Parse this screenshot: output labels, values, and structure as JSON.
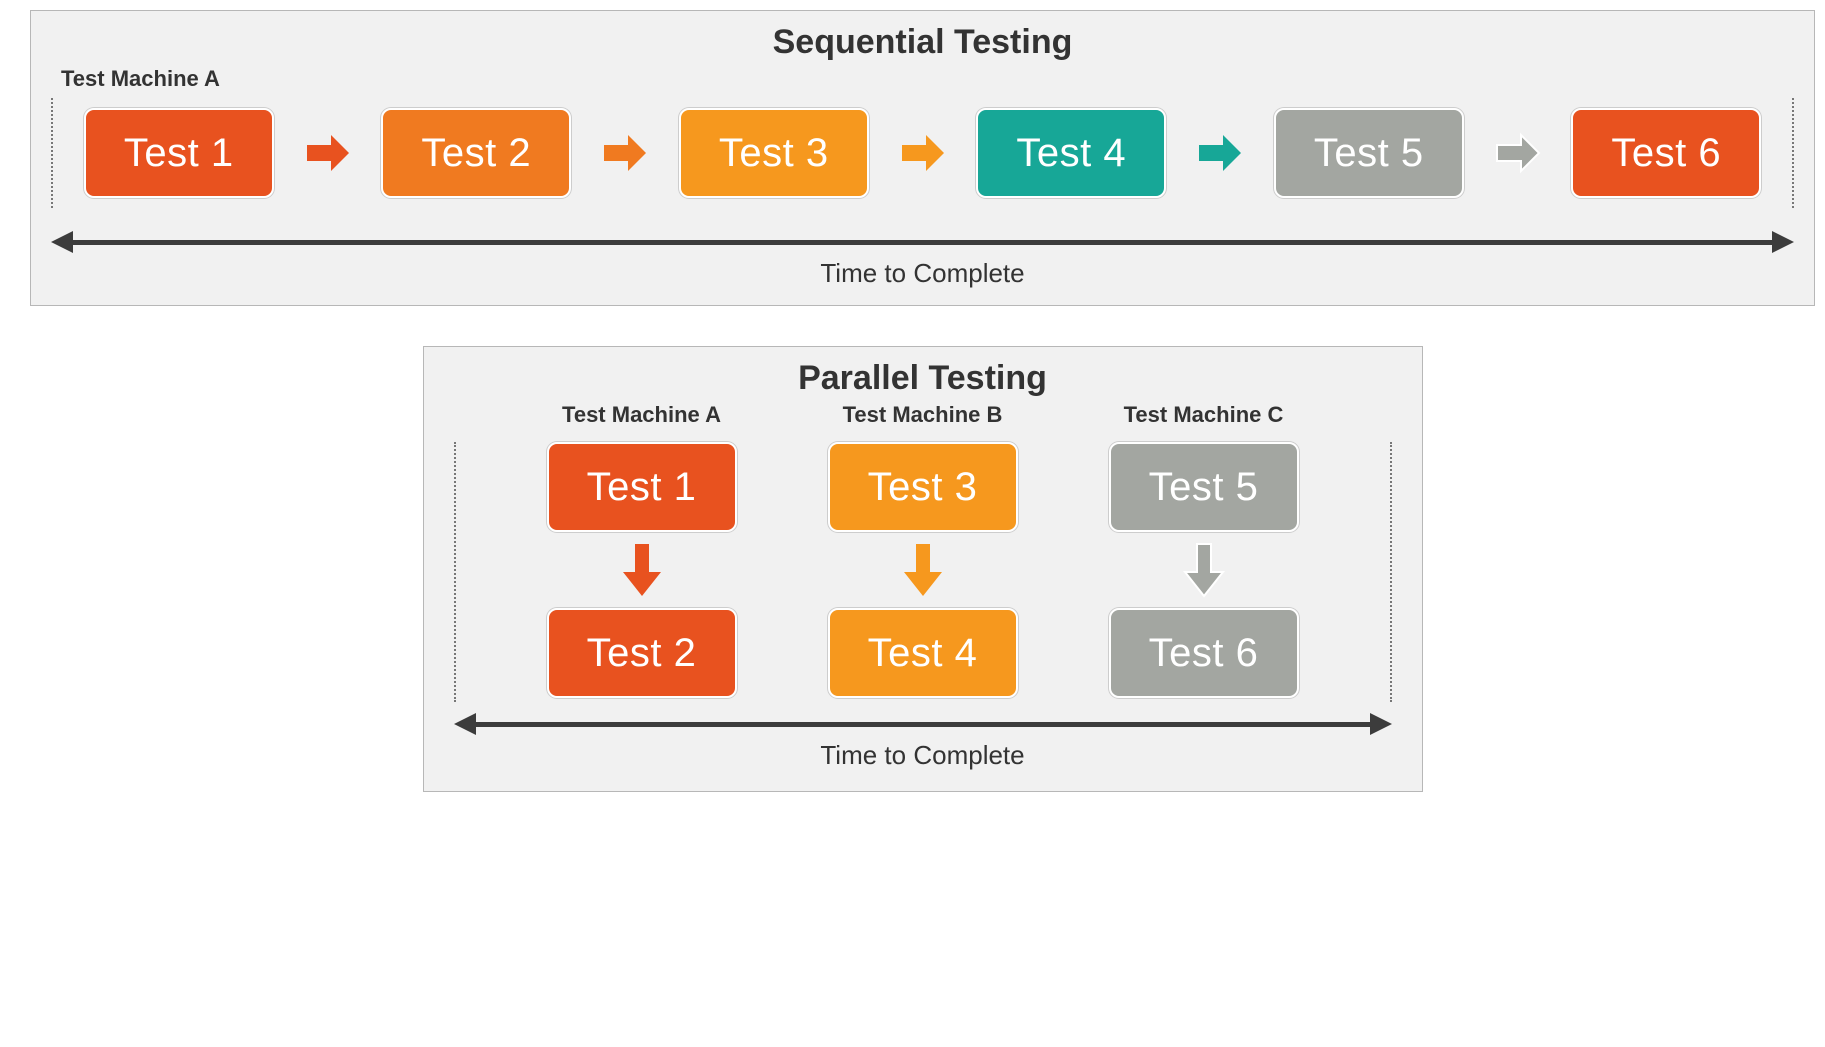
{
  "sequential": {
    "title": "Sequential Testing",
    "machine_label": "Test Machine A",
    "tests": [
      {
        "label": "Test 1",
        "box_class": "bg-orange1",
        "arrow_class": "fill-orange1"
      },
      {
        "label": "Test 2",
        "box_class": "bg-orange2",
        "arrow_class": "fill-orange2"
      },
      {
        "label": "Test 3",
        "box_class": "bg-orange3",
        "arrow_class": "fill-orange3"
      },
      {
        "label": "Test 4",
        "box_class": "bg-teal",
        "arrow_class": "fill-teal"
      },
      {
        "label": "Test 5",
        "box_class": "bg-gray",
        "arrow_class": "fill-gray"
      },
      {
        "label": "Test 6",
        "box_class": "bg-orange1",
        "arrow_class": ""
      }
    ],
    "time_caption": "Time to Complete"
  },
  "parallel": {
    "title": "Parallel Testing",
    "time_caption": "Time to Complete",
    "columns": [
      {
        "machine_label": "Test Machine A",
        "top": {
          "label": "Test 1",
          "box_class": "bg-orange1"
        },
        "arrow_class": "fill-orange1",
        "bottom": {
          "label": "Test 2",
          "box_class": "bg-orange1"
        }
      },
      {
        "machine_label": "Test Machine B",
        "top": {
          "label": "Test 3",
          "box_class": "bg-orange3"
        },
        "arrow_class": "fill-orange3",
        "bottom": {
          "label": "Test 4",
          "box_class": "bg-orange3"
        }
      },
      {
        "machine_label": "Test Machine C",
        "top": {
          "label": "Test 5",
          "box_class": "bg-gray"
        },
        "arrow_class": "fill-gray",
        "bottom": {
          "label": "Test 6",
          "box_class": "bg-gray"
        }
      }
    ]
  }
}
